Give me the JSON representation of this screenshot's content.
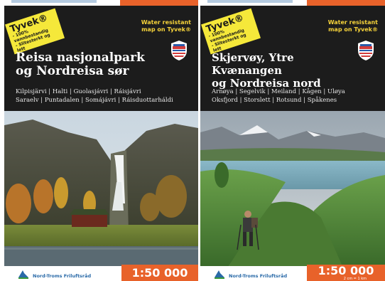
{
  "maps": [
    {
      "badge": {
        "brand": "Tyvek®",
        "lines": [
          "- 100% vannbestandig",
          "- Slitesterkt og lett"
        ]
      },
      "water_resistant": "Water resistant map on Tyvek®",
      "title_line1": "Reisa nasjonalpark",
      "title_line2": "og Nordreisa sør",
      "places_line1": "Kilpisjärvi | Halti | Guolasjávri | Ráisjávri",
      "places_line2": "Saraelv | Puntadalen | Somájávri | Ráisduottarháldi",
      "scale": "1:50 000",
      "publisher": "Nord-Troms Friluftsråd"
    },
    {
      "badge": {
        "brand": "Tyvek®",
        "lines": [
          "- 100% vannbestandig",
          "- Slitesterkt og lett"
        ]
      },
      "water_resistant": "Water resistant map on Tyvek®",
      "title_line1": "Skjervøy, Ytre Kvænangen",
      "title_line2": "og Nordreisa nord",
      "places_line1": "Arnøya | Segelvik | Meiland | Kågen | Uløya",
      "places_line2": "Oksfjord | Storslett | Rotsund | Spåkenes",
      "scale": "1:50 000",
      "scale_sub": "2 cm = 1 km",
      "publisher": "Nord-Troms Friluftsråd"
    }
  ],
  "colors": {
    "panel": "#1c1c1c",
    "badge": "#f5e83a",
    "accent_text": "#f5d23a",
    "scale_bg": "#e8622a",
    "publisher": "#2a6aa8"
  },
  "icons": [
    "calazo-shield-icon",
    "publisher-logo-icon"
  ]
}
